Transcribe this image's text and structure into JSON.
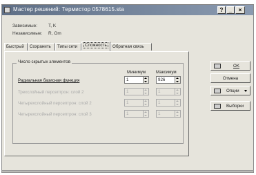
{
  "window": {
    "title": "Мастер решений: Термистор 0578615.sta",
    "buttons": {
      "help": "?",
      "minimize": "_",
      "close": "×"
    }
  },
  "info": [
    {
      "label": "Зависимые:",
      "value": "T, K"
    },
    {
      "label": "Независимые:",
      "value": "R, Om"
    }
  ],
  "tabs": [
    {
      "label": "Быстрый",
      "active": false
    },
    {
      "label": "Сохранить",
      "active": false
    },
    {
      "label": "Типы сети",
      "active": false
    },
    {
      "label": "Сложность",
      "active": true
    },
    {
      "label": "Обратная связь",
      "active": false
    }
  ],
  "group": {
    "title": "Число скрытых элементов",
    "col_min": "Минимум",
    "col_max": "Максимум",
    "rows": [
      {
        "label": "Радиальная базисная функция",
        "min": "1",
        "max": "926",
        "enabled": true
      },
      {
        "label": "Трехслойный персептрон: слой 2",
        "min": "1",
        "max": "1",
        "enabled": false
      },
      {
        "label": "Четырехслойный персептрон: слой 2",
        "min": "1",
        "max": "1",
        "enabled": false
      },
      {
        "label": "Четырехслойный персептрон: слой 3",
        "min": "1",
        "max": "1",
        "enabled": false
      }
    ]
  },
  "side_buttons": {
    "ok": "OK",
    "cancel": "Отмена",
    "options": "Опции",
    "select": "Выборки"
  }
}
